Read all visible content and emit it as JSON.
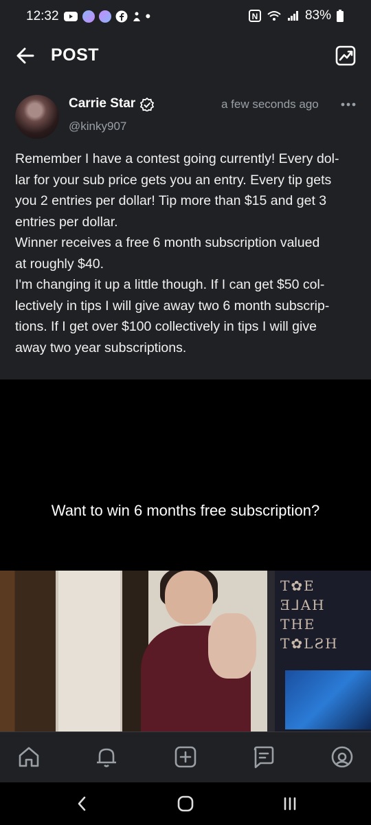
{
  "status_bar": {
    "time": "12:32",
    "battery": "83%"
  },
  "header": {
    "title": "POST"
  },
  "post": {
    "author_name": "Carrie Star",
    "handle": "@kinky907",
    "timestamp": "a few seconds ago",
    "body": "Remember I have a contest going currently! Every dol-\nlar for your sub price gets you an entry. Every tip gets\nyou 2 entries per dollar! Tip more than $15 and get 3\nentries per dollar.\nWinner receives a free 6 month subscription valued\nat roughly $40.\nI'm changing it up a little though. If I can get $50 col-\nlectively in tips I will give away two 6 month subscrip-\ntions. If I get over $100 collectively in tips I will give\naway two year subscriptions."
  },
  "media": {
    "caption": "Want to win 6 months free subscription?",
    "poster_text": "T✿E\nƎ⅃AH\nTHE\nT✿LƧH"
  },
  "bottom_nav": {
    "items": [
      "home-icon",
      "notifications-icon",
      "add-icon",
      "messages-icon",
      "profile-icon"
    ]
  },
  "colors": {
    "background": "#202124",
    "muted_text": "#9aa0a6",
    "accent": "#ffffff"
  }
}
